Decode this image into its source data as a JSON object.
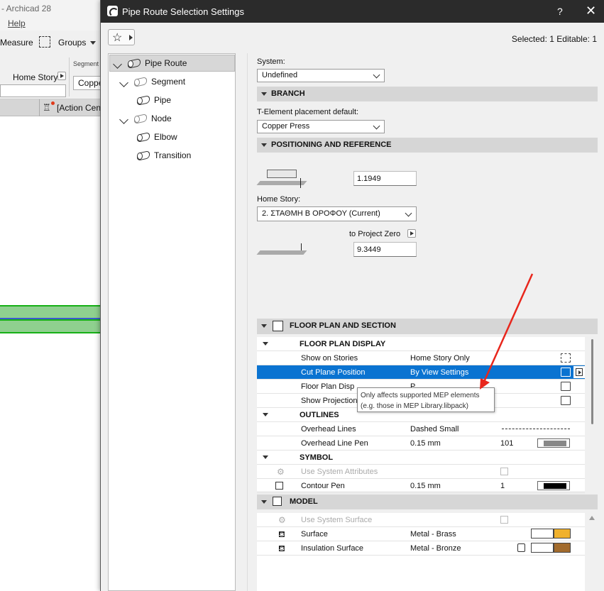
{
  "background_app": {
    "title": "- Archicad 28",
    "menu_help": "Help",
    "measure": "Measure",
    "groups": "Groups",
    "segment": "Segment",
    "home_story": "Home Story",
    "copper_partial": "Coppe",
    "action_center": "[Action Cent"
  },
  "dialog": {
    "title": "Pipe Route Selection Settings",
    "help_button": "?",
    "close_button": "✕",
    "favorites_icon": "star-icon",
    "selected_info": "Selected: 1 Editable: 1"
  },
  "tree": {
    "items": [
      {
        "label": "Pipe Route"
      },
      {
        "label": "Segment"
      },
      {
        "label": "Pipe"
      },
      {
        "label": "Node"
      },
      {
        "label": "Elbow"
      },
      {
        "label": "Transition"
      }
    ]
  },
  "settings": {
    "system_label": "System:",
    "system_value": "Undefined",
    "branch_header": "BRANCH",
    "t_element_label": "T-Element placement default:",
    "t_element_value": "Copper Press",
    "positioning_header": "POSITIONING AND REFERENCE",
    "height_value": "1.1949",
    "home_story_label": "Home Story:",
    "home_story_value": "2. ΣΤΑΘΜΗ Β ΟΡΟΦΟΥ (Current)",
    "to_project_zero_label": "to Project Zero",
    "to_project_zero_value": "9.3449",
    "floor_plan_header": "FLOOR PLAN AND SECTION",
    "model_header": "MODEL"
  },
  "floor_plan_grid": {
    "floor_plan_display_header": "FLOOR PLAN DISPLAY",
    "rows": [
      {
        "label": "Show on Stories",
        "value": "Home Story Only"
      },
      {
        "label": "Cut Plane Position",
        "value": "By View Settings"
      },
      {
        "label": "Floor Plan Disp",
        "value": "P"
      },
      {
        "label": "Show Projection",
        "value": ""
      }
    ],
    "outlines_header": "OUTLINES",
    "overhead_lines_label": "Overhead Lines",
    "overhead_lines_value": "Dashed Small",
    "overhead_pen_label": "Overhead Line Pen",
    "overhead_pen_value": "0.15 mm",
    "overhead_pen_number": "101",
    "symbol_header": "SYMBOL",
    "use_system_attributes": "Use System Attributes",
    "contour_pen_label": "Contour Pen",
    "contour_pen_value": "0.15 mm",
    "contour_pen_number": "1"
  },
  "model_grid": {
    "use_system_surface": "Use System Surface",
    "surface_label": "Surface",
    "surface_value": "Metal - Brass",
    "insulation_label": "Insulation Surface",
    "insulation_value": "Metal - Bronze"
  },
  "tooltip": {
    "line1": "Only affects supported MEP elements",
    "line2": "(e.g. those in MEP Library.libpack)"
  },
  "colors": {
    "selection_blue": "#0a73d1",
    "annotation_arrow": "#e8261c",
    "brass": "#f0b12c",
    "bronze": "#a26b2c"
  }
}
